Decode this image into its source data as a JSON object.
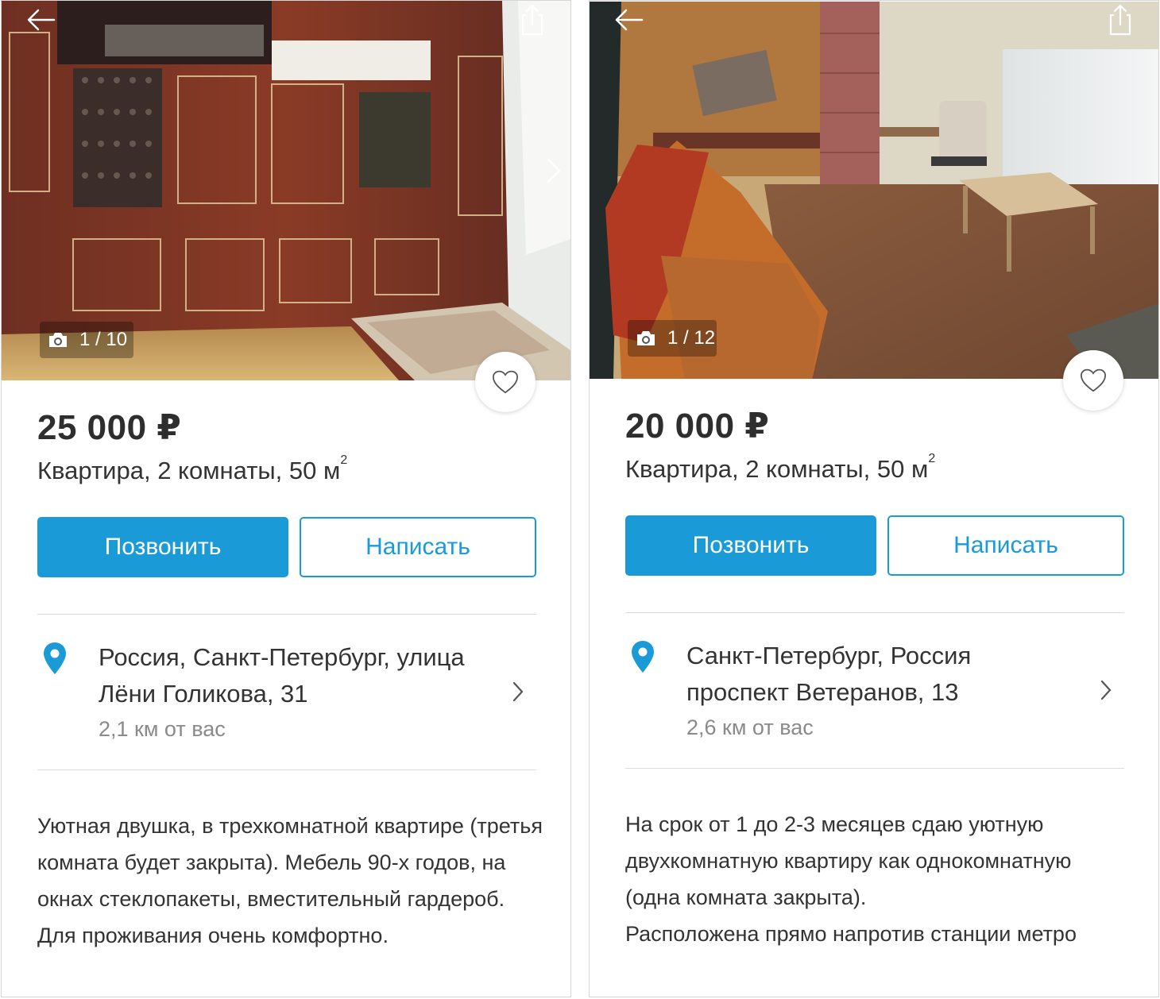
{
  "listings": [
    {
      "photo_counter": "1 / 10",
      "price": "25 000 ₽",
      "subtitle": "Квартира, 2 комнаты, 50 м",
      "area_unit_sup": "2",
      "call_label": "Позвонить",
      "write_label": "Написать",
      "address_line1": "Россия, Санкт-Петербург, улица",
      "address_line2": "Лёни Голикова, 31",
      "distance": "2,1  км от вас",
      "description": "Уютная двушка, в трехкомнатной квартире (третья комната будет закрыта). Мебель 90-х годов, на окнах стеклопакеты, вместительный гардероб. Для проживания очень комфортно."
    },
    {
      "photo_counter": "1 / 12",
      "price": "20 000 ₽",
      "subtitle": "Квартира, 2 комнаты, 50 м",
      "area_unit_sup": "2",
      "call_label": "Позвонить",
      "write_label": "Написать",
      "address_line1": "Санкт-Петербург, Россия",
      "address_line2": "проспект Ветеранов, 13",
      "distance": "2,6  км от вас",
      "description_lines": [
        "На срок от 1 до 2-3 месяцев сдаю уютную",
        "двухкомнатную квартиру как однокомнатную",
        "(одна комната закрыта).",
        "Расположена прямо напротив станции метро"
      ]
    }
  ],
  "icons": {
    "back": "arrow-left-icon",
    "share": "share-icon",
    "next": "chevron-right-icon",
    "camera": "camera-icon",
    "favorite": "heart-outline-icon",
    "location": "map-pin-icon"
  },
  "colors": {
    "accent": "#1a9bd7",
    "text_primary": "#333333",
    "text_secondary": "#8a8a8a"
  }
}
